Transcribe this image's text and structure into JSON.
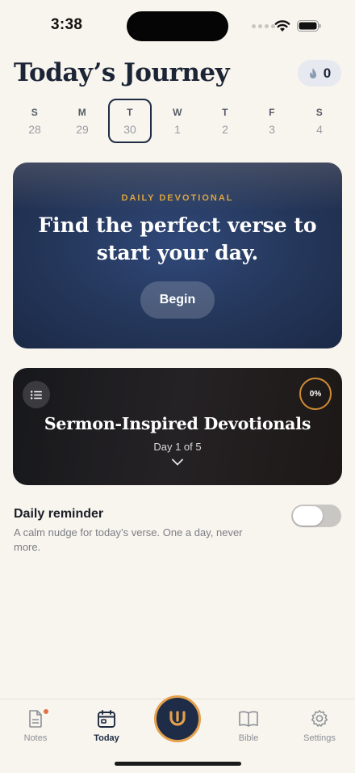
{
  "status_bar": {
    "time": "3:38"
  },
  "header": {
    "title": "Today’s Journey",
    "streak_count": "0"
  },
  "week": {
    "days": [
      {
        "dow": "S",
        "num": "28"
      },
      {
        "dow": "M",
        "num": "29"
      },
      {
        "dow": "T",
        "num": "30",
        "selected": true
      },
      {
        "dow": "W",
        "num": "1"
      },
      {
        "dow": "T",
        "num": "2"
      },
      {
        "dow": "F",
        "num": "3"
      },
      {
        "dow": "S",
        "num": "4"
      }
    ]
  },
  "devotional": {
    "eyebrow": "DAILY DEVOTIONAL",
    "heading": "Find the perfect verse to start your day.",
    "button_label": "Begin"
  },
  "sermon": {
    "title": "Sermon-Inspired Devotionals",
    "subtitle": "Day 1 of 5",
    "progress_label": "0%",
    "progress_percent": 0
  },
  "reminder": {
    "title": "Daily reminder",
    "description": "A calm nudge for today’s verse. One a day, never more.",
    "enabled": false
  },
  "tabs": [
    {
      "label": "Notes",
      "icon": "note-icon",
      "badge": true
    },
    {
      "label": "Today",
      "icon": "calendar-icon",
      "active": true
    },
    {
      "label": "",
      "icon": "app-logo-icon"
    },
    {
      "label": "Bible",
      "icon": "book-icon"
    },
    {
      "label": "Settings",
      "icon": "gear-icon"
    }
  ],
  "colors": {
    "background": "#f8f4ee",
    "navy": "#1e2c48",
    "accent_gold": "#d9a441",
    "notification_dot": "#e0724a"
  }
}
